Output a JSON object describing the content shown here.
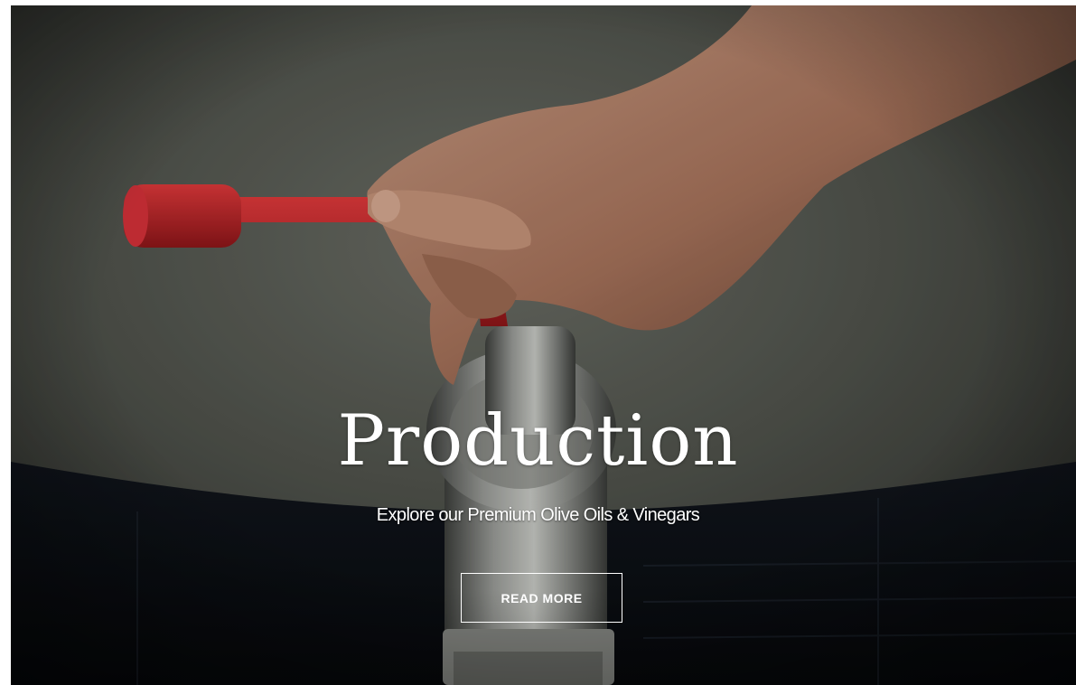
{
  "hero": {
    "title": "Production",
    "subtitle": "Explore our Premium Olive Oils & Vinegars",
    "cta_label": "READ MORE",
    "image_icon": "olive-oil-tank-valve-photo"
  },
  "colors": {
    "text": "#ffffff",
    "valve_red": "#c8262a",
    "tank_gray": "#4a4d47",
    "dark_bg": "#141a24"
  }
}
